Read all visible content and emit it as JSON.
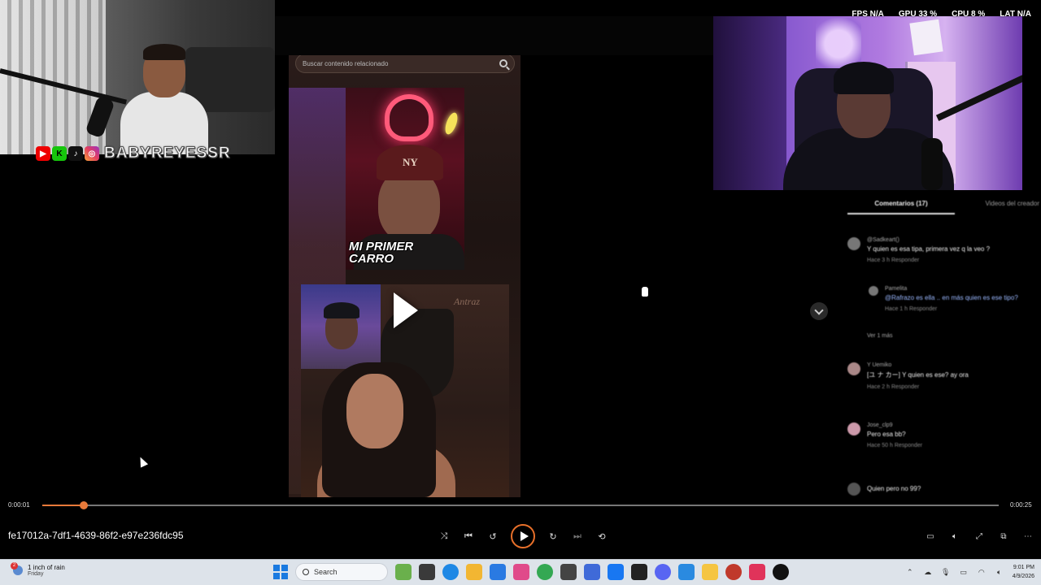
{
  "overlay": {
    "fps_label": "FPS",
    "fps_value": "N/A",
    "gpu_label": "GPU",
    "gpu_value": "33 %",
    "cpu_label": "CPU",
    "cpu_value": "8 %",
    "lat_label": "LAT",
    "lat_value": "N/A"
  },
  "streamer": {
    "handle": "BABYREYESSR",
    "social_icons": [
      "youtube-icon",
      "kick-icon",
      "tiktok-icon",
      "instagram-icon"
    ]
  },
  "related": {
    "search_placeholder": "Buscar contenido relacionado",
    "video1_title_line1": "MI PRIMER",
    "video1_title_line2": "CARRO",
    "video1_cap_text": "NY",
    "video2_watermark": "Antraz"
  },
  "comments": {
    "tab_active": "Comentarios (17)",
    "tab_other": "Videos del creador",
    "items": [
      {
        "user": "@Sadkeart()",
        "text": "Y quien es esa tipa, primera vez q la veo ?",
        "meta": "Hace 3 h   Responder"
      },
      {
        "user": "Pamelita",
        "text": "@Rafrazo es ella .. en más quien es ese tipo?",
        "meta": "Hace 1 h   Responder"
      },
      {
        "user": "Y   Uemiko",
        "text": "[ユ ナ カー] Y quien es ese? ay ora",
        "meta": "Hace 2 h   Responder"
      },
      {
        "user": "Jose_clp9",
        "text": "Pero esa bb?",
        "meta": "Hace 50 h   Responder"
      },
      {
        "user": "",
        "text": "Quien pero no 99?",
        "meta": ""
      }
    ],
    "more_replies": "Ver 1 más"
  },
  "player": {
    "time_current": "0:00:01",
    "time_total": "0:00:25",
    "progress_fraction": 0.043,
    "filename": "fe17012a-7df1-4639-86f2-e97e236fdc95",
    "accent": "#e8702a"
  },
  "taskbar": {
    "weather_line1": "1 inch of rain",
    "weather_line2": "Friday",
    "weather_badge": "2",
    "search_label": "Search",
    "time": "9:01 PM",
    "date": "4/9/2026"
  }
}
